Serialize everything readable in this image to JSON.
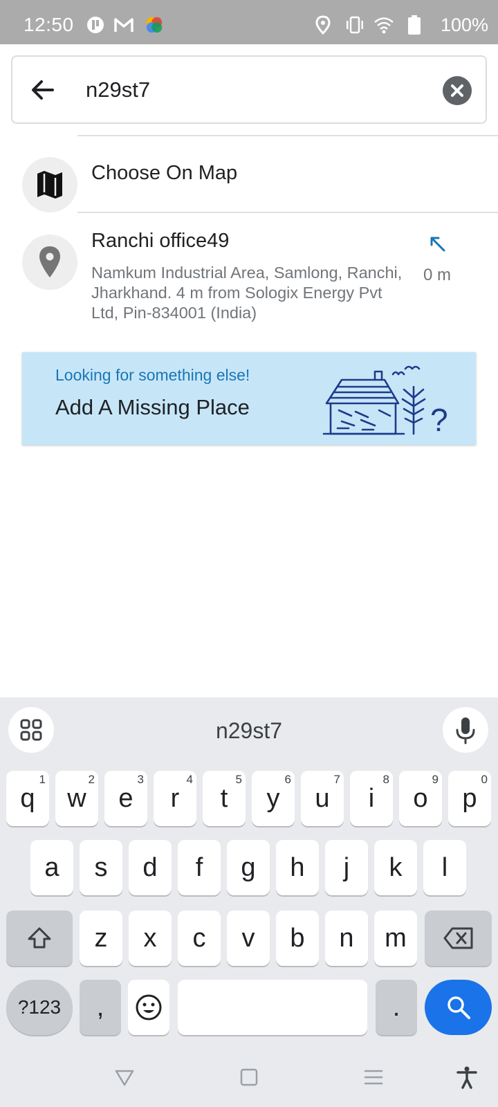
{
  "status_bar": {
    "time": "12:50",
    "battery_text": "100%",
    "icons": [
      "app-notification-icon",
      "gmail-icon",
      "photos-icon",
      "location-icon",
      "vibrate-icon",
      "wifi-icon",
      "battery-icon"
    ]
  },
  "search": {
    "value": "n29st7",
    "back_icon": "back-arrow-icon",
    "clear_icon": "clear-icon"
  },
  "choose_on_map": {
    "label": "Choose On Map",
    "icon": "map-icon"
  },
  "results": [
    {
      "title": "Ranchi office49",
      "address": "Namkum Industrial Area, Samlong, Ranchi, Jharkhand. 4 m from Sologix Energy Pvt Ltd, Pin-834001 (India)",
      "distance": "0 m",
      "icon": "location-pin-icon",
      "direction_icon": "direction-arrow-icon"
    }
  ],
  "banner": {
    "subtitle": "Looking for something else!",
    "title": "Add A Missing Place",
    "subtitle_color": "#1a76b5",
    "background": "#c6e6f8"
  },
  "keyboard": {
    "suggestion": "n29st7",
    "row1": [
      {
        "key": "q",
        "hint": "1"
      },
      {
        "key": "w",
        "hint": "2"
      },
      {
        "key": "e",
        "hint": "3"
      },
      {
        "key": "r",
        "hint": "4"
      },
      {
        "key": "t",
        "hint": "5"
      },
      {
        "key": "y",
        "hint": "6"
      },
      {
        "key": "u",
        "hint": "7"
      },
      {
        "key": "i",
        "hint": "8"
      },
      {
        "key": "o",
        "hint": "9"
      },
      {
        "key": "p",
        "hint": "0"
      }
    ],
    "row2": [
      "a",
      "s",
      "d",
      "f",
      "g",
      "h",
      "j",
      "k",
      "l"
    ],
    "row3": [
      "z",
      "x",
      "c",
      "v",
      "b",
      "n",
      "m"
    ],
    "symbols_label": "?123",
    "comma_label": ",",
    "period_label": ".",
    "accent_color": "#1a73e8"
  },
  "nav_bar": {
    "icons": [
      "back-triangle-icon",
      "home-square-icon",
      "menu-icon",
      "accessibility-icon"
    ]
  }
}
